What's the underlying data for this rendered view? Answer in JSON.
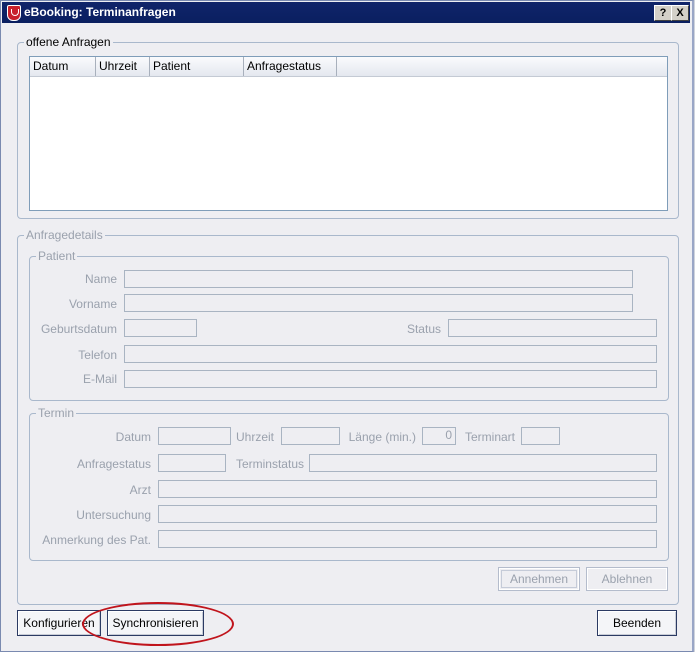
{
  "window": {
    "title": "eBooking: Terminanfragen",
    "help_label": "?",
    "close_label": "X"
  },
  "offene_anfragen": {
    "legend": "offene Anfragen",
    "columns": [
      "Datum",
      "Uhrzeit",
      "Patient",
      "Anfragestatus"
    ],
    "rows": []
  },
  "anfragedetails": {
    "legend": "Anfragedetails",
    "patient": {
      "legend": "Patient",
      "name_label": "Name",
      "vorname_label": "Vorname",
      "geburtsdatum_label": "Geburtsdatum",
      "status_label": "Status",
      "telefon_label": "Telefon",
      "email_label": "E-Mail"
    },
    "termin": {
      "legend": "Termin",
      "datum_label": "Datum",
      "uhrzeit_label": "Uhrzeit",
      "laenge_label": "Länge (min.)",
      "laenge_value": "0",
      "terminart_label": "Terminart",
      "anfragestatus_label": "Anfragestatus",
      "terminstatus_label": "Terminstatus",
      "arzt_label": "Arzt",
      "untersuchung_label": "Untersuchung",
      "anmerkung_label": "Anmerkung des Pat."
    },
    "annehmen_label": "Annehmen",
    "ablehnen_label": "Ablehnen"
  },
  "footer": {
    "konfigurieren_label": "Konfigurieren",
    "synchronisieren_label": "Synchronisieren",
    "beenden_label": "Beenden"
  },
  "colors": {
    "titlebar": "#0a1f60",
    "annotation_circle": "#c0141c"
  }
}
